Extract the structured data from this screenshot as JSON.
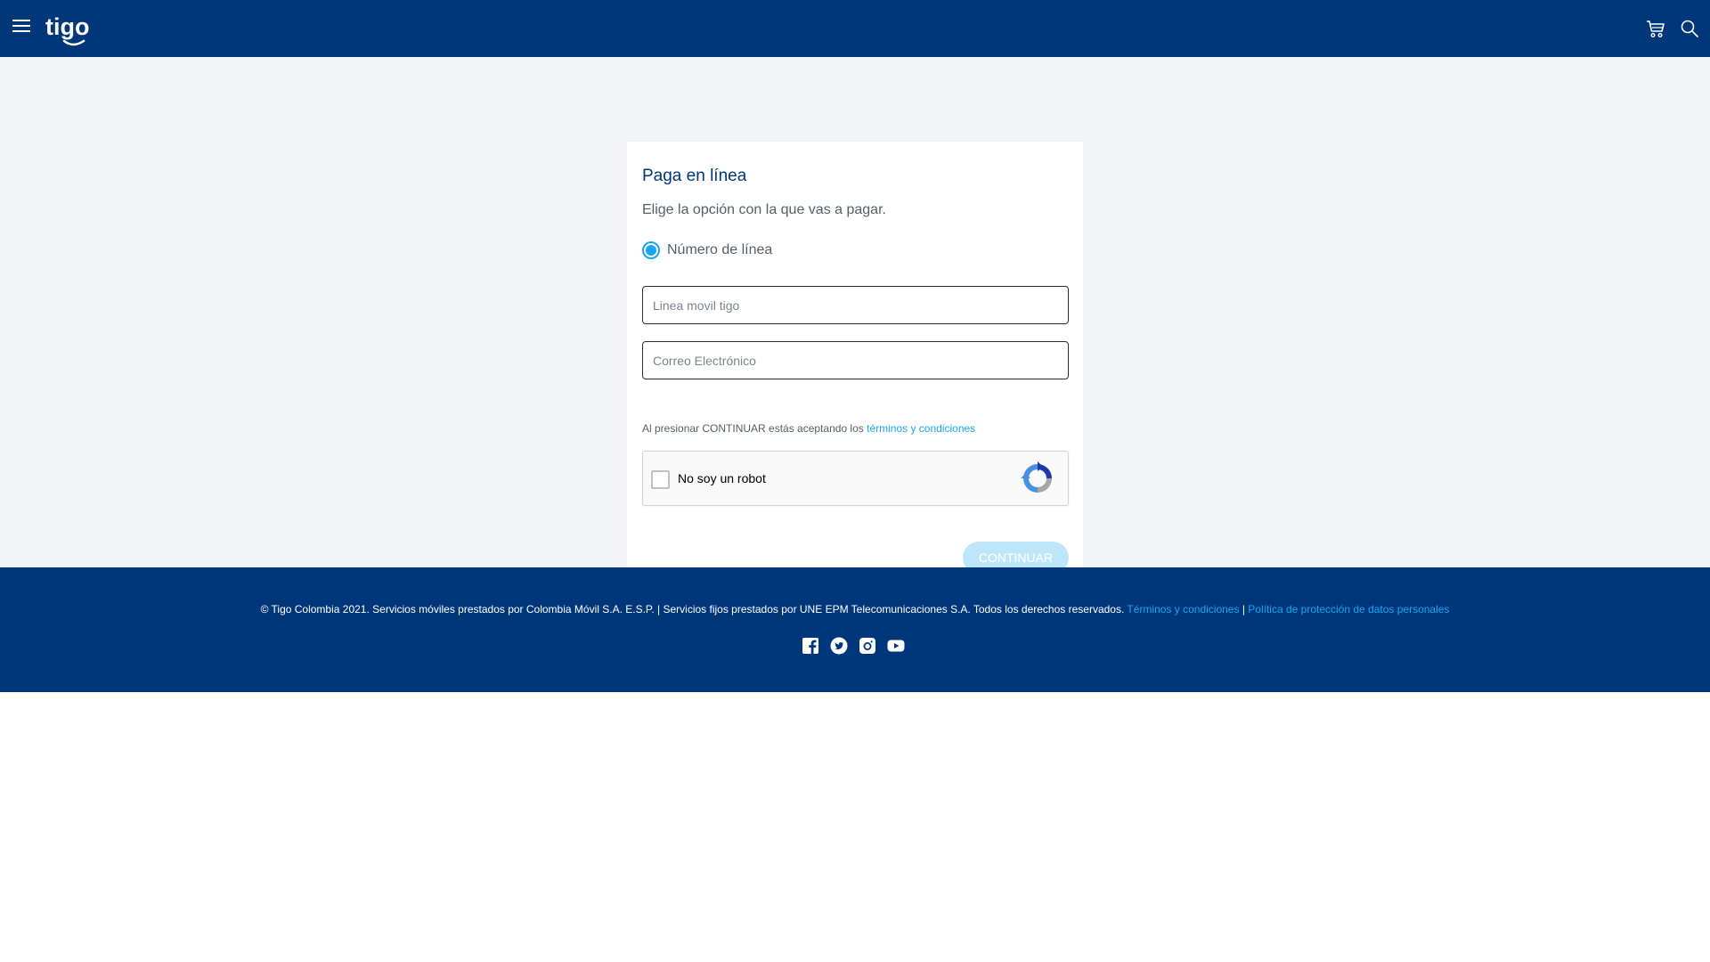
{
  "header": {
    "logo_text": "tigo"
  },
  "card": {
    "title": "Paga en línea",
    "subtitle": "Elige la opción con la que vas a pagar.",
    "radio_label": "Número de línea",
    "line_placeholder": "Linea movil tigo",
    "email_placeholder": "Correo Electrónico",
    "terms_prefix": "Al presionar CONTINUAR estás aceptando los ",
    "terms_link": "términos y condiciones",
    "recaptcha_label": "No soy un robot",
    "continue_label": "CONTINUAR"
  },
  "footer": {
    "copyright": "© Tigo Colombia 2021. Servicios móviles prestados por Colombia Móvil S.A. E.S.P. | Servicios fijos prestados por UNE EPM Telecomunicaciones S.A. Todos los derechos reservados. ",
    "terms_link": "Términos y condiciones",
    "separator": " | ",
    "privacy_link": "Política de protección de datos personales",
    "social": [
      "facebook-icon",
      "twitter-icon",
      "instagram-icon",
      "youtube-icon"
    ]
  },
  "colors": {
    "brand_navy": "#00377b",
    "accent_cyan": "#18a6f0",
    "button_disabled": "#bde6fb",
    "page_background": "#f3f4f6"
  }
}
